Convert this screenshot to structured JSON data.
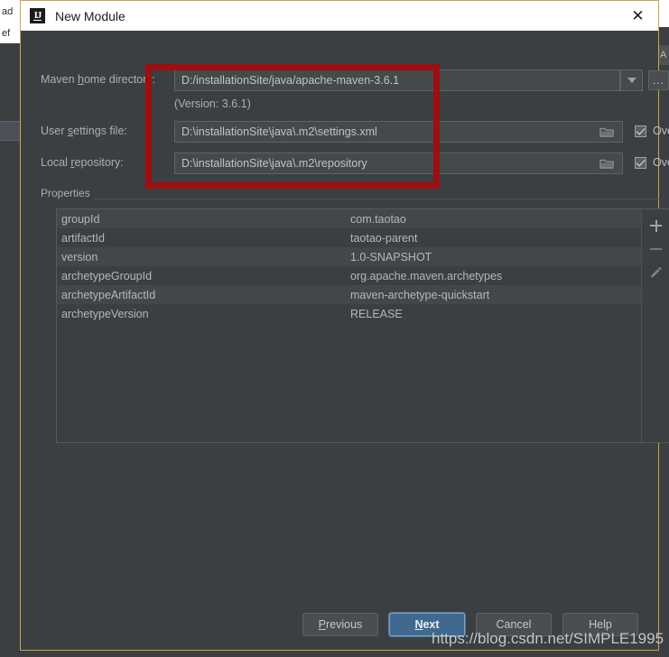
{
  "background": {
    "left_strip_1": "ad",
    "left_strip_2": "ef",
    "right_strip": "A"
  },
  "window": {
    "title": "New Module",
    "logo": "intellij-idea-logo",
    "close": "✕"
  },
  "form": {
    "maven_home": {
      "label_pre": "Maven ",
      "label_mn": "h",
      "label_post": "ome directory:",
      "value": "D:/installationSite/java/apache-maven-3.6.1",
      "browse_label": "...",
      "version_note": "(Version: 3.6.1)"
    },
    "user_settings": {
      "label_pre": "User ",
      "label_mn": "s",
      "label_post": "ettings file:",
      "value": "D:\\installationSite\\java\\.m2\\settings.xml",
      "override_label": "Override",
      "override_checked": true
    },
    "local_repository": {
      "label_pre": "Local ",
      "label_mn": "r",
      "label_post": "epository:",
      "value": "D:\\installationSite\\java\\.m2\\repository",
      "override_label": "Override",
      "override_checked": true
    }
  },
  "properties": {
    "group_title": "Properties",
    "rows": [
      {
        "key": "groupId",
        "value": "com.taotao"
      },
      {
        "key": "artifactId",
        "value": "taotao-parent"
      },
      {
        "key": "version",
        "value": "1.0-SNAPSHOT"
      },
      {
        "key": "archetypeGroupId",
        "value": "org.apache.maven.archetypes"
      },
      {
        "key": "archetypeArtifactId",
        "value": "maven-archetype-quickstart"
      },
      {
        "key": "archetypeVersion",
        "value": "RELEASE"
      }
    ],
    "toolbar": {
      "add": "add-icon",
      "remove": "remove-icon",
      "edit": "edit-pencil-icon"
    }
  },
  "buttons": {
    "previous_pre": "",
    "previous_mn": "P",
    "previous_post": "revious",
    "next_pre": "",
    "next_mn": "N",
    "next_post": "ext",
    "cancel": "Cancel",
    "help": "Help"
  },
  "annotation": {
    "highlight_color": "#9c0f12"
  },
  "watermark": "https://blog.csdn.net/SIMPLE1995"
}
